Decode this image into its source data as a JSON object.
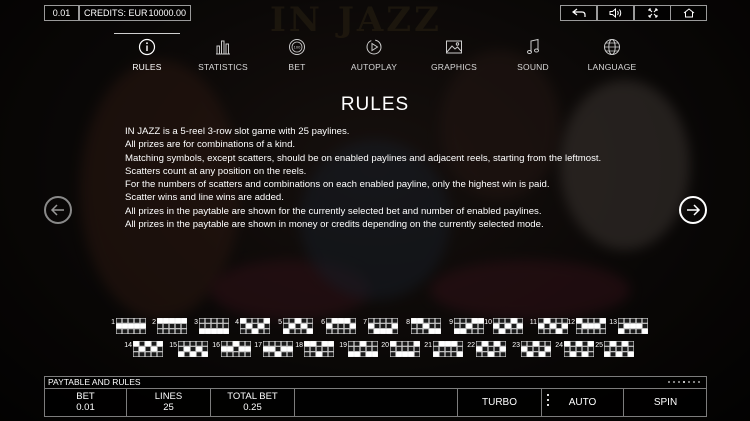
{
  "topbar": {
    "bet": "0.01",
    "credits_label": "CREDITS: EUR",
    "credits_value": "10000.00"
  },
  "icons": [
    "back-icon",
    "volume-icon",
    "fullscreen-icon",
    "home-icon"
  ],
  "tabs": [
    {
      "label": "RULES",
      "icon": "info-icon",
      "active": true
    },
    {
      "label": "STATISTICS",
      "icon": "bar-chart-icon"
    },
    {
      "label": "BET",
      "icon": "coin-icon"
    },
    {
      "label": "AUTOPLAY",
      "icon": "autoplay-icon"
    },
    {
      "label": "GRAPHICS",
      "icon": "image-icon"
    },
    {
      "label": "SOUND",
      "icon": "music-note-icon"
    },
    {
      "label": "LANGUAGE",
      "icon": "globe-icon"
    }
  ],
  "rules": {
    "title": "RULES",
    "lines": [
      "IN JAZZ is a 5-reel 3-row slot game with 25 paylines.",
      "All prizes are for combinations of a kind.",
      "Matching symbols, except scatters, should be on enabled paylines and adjacent reels, starting from the leftmost.",
      "Scatters count at any position on the reels.",
      "For the numbers of scatters and combinations on each enabled payline, only the highest win is paid.",
      "Scatter wins and line wins are added.",
      "All prizes in the paytable are shown for the currently selected bet and number of enabled paylines.",
      "All prizes in the paytable are shown in money or credits depending on the currently selected mode."
    ]
  },
  "paylines": [
    {
      "n": "1",
      "rows": [
        1,
        1,
        1,
        1,
        1
      ]
    },
    {
      "n": "2",
      "rows": [
        0,
        0,
        0,
        0,
        0
      ]
    },
    {
      "n": "3",
      "rows": [
        2,
        2,
        2,
        2,
        2
      ]
    },
    {
      "n": "4",
      "rows": [
        0,
        1,
        2,
        1,
        0
      ]
    },
    {
      "n": "5",
      "rows": [
        2,
        1,
        0,
        1,
        2
      ]
    },
    {
      "n": "6",
      "rows": [
        1,
        0,
        0,
        0,
        1
      ]
    },
    {
      "n": "7",
      "rows": [
        1,
        2,
        2,
        2,
        1
      ]
    },
    {
      "n": "8",
      "rows": [
        0,
        0,
        1,
        2,
        2
      ]
    },
    {
      "n": "9",
      "rows": [
        2,
        2,
        1,
        0,
        0
      ]
    },
    {
      "n": "10",
      "rows": [
        1,
        2,
        1,
        0,
        1
      ]
    },
    {
      "n": "11",
      "rows": [
        1,
        0,
        1,
        2,
        1
      ]
    },
    {
      "n": "12",
      "rows": [
        0,
        1,
        1,
        1,
        0
      ]
    },
    {
      "n": "13",
      "rows": [
        2,
        1,
        1,
        1,
        2
      ]
    },
    {
      "n": "14",
      "rows": [
        0,
        1,
        0,
        1,
        0
      ]
    },
    {
      "n": "15",
      "rows": [
        2,
        1,
        2,
        1,
        2
      ]
    },
    {
      "n": "16",
      "rows": [
        1,
        1,
        0,
        1,
        1
      ]
    },
    {
      "n": "17",
      "rows": [
        1,
        1,
        2,
        1,
        1
      ]
    },
    {
      "n": "18",
      "rows": [
        0,
        0,
        2,
        0,
        0
      ]
    },
    {
      "n": "19",
      "rows": [
        2,
        2,
        0,
        2,
        2
      ]
    },
    {
      "n": "20",
      "rows": [
        0,
        2,
        2,
        2,
        0
      ]
    },
    {
      "n": "21",
      "rows": [
        2,
        0,
        0,
        0,
        2
      ]
    },
    {
      "n": "22",
      "rows": [
        1,
        0,
        2,
        0,
        1
      ]
    },
    {
      "n": "23",
      "rows": [
        1,
        2,
        0,
        2,
        1
      ]
    },
    {
      "n": "24",
      "rows": [
        0,
        2,
        0,
        2,
        0
      ]
    },
    {
      "n": "25",
      "rows": [
        2,
        0,
        2,
        0,
        2
      ]
    }
  ],
  "bottom": {
    "paytable_label": "PAYTABLE AND RULES",
    "bet_label": "BET",
    "bet_value": "0.01",
    "lines_label": "LINES",
    "lines_value": "25",
    "total_label": "TOTAL BET",
    "total_value": "0.25",
    "turbo": "TURBO",
    "auto": "AUTO",
    "spin": "SPIN"
  },
  "colors": {
    "accent": "#ffffff",
    "border": "#9a9a9a"
  }
}
